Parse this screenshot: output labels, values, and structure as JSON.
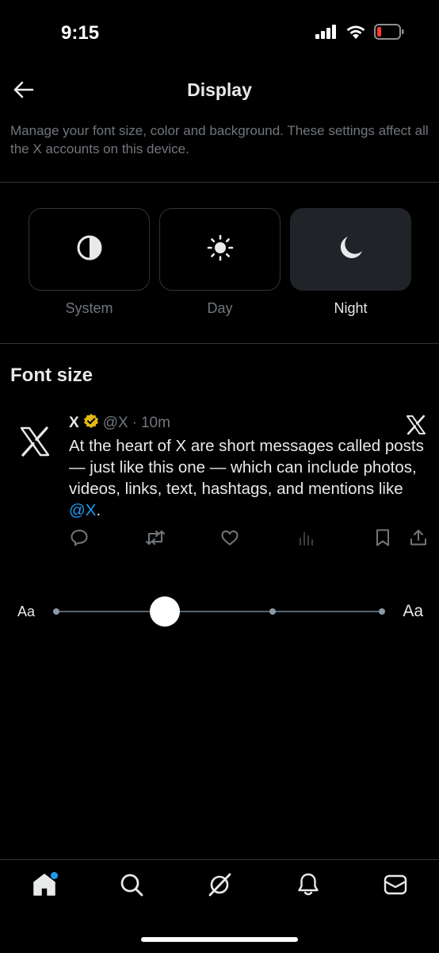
{
  "status_bar": {
    "time": "9:15",
    "icons": [
      "signal-icon",
      "wifi-icon",
      "battery-low-icon"
    ]
  },
  "header": {
    "title": "Display",
    "back_icon": "arrow-left-icon"
  },
  "description": "Manage your font size, color and background. These settings affect all the X accounts on this device.",
  "themes": [
    {
      "label": "System",
      "icon": "contrast-icon",
      "selected": false
    },
    {
      "label": "Day",
      "icon": "sun-icon",
      "selected": false
    },
    {
      "label": "Night",
      "icon": "moon-icon",
      "selected": true
    }
  ],
  "font_size": {
    "title": "Font size",
    "small_label": "Aa",
    "large_label": "Aa",
    "steps": 5,
    "selected_step": 2
  },
  "preview_post": {
    "name": "X",
    "verified": true,
    "handle": "@X",
    "dot": "·",
    "time": "10m",
    "text_before": "At the heart of X are short messages called posts — just like this one — which can include photos, videos, links, text, hashtags, and mentions like ",
    "mention": "@X",
    "text_after": ".",
    "actions": [
      "reply-icon",
      "repost-icon",
      "like-icon",
      "views-icon",
      "bookmark-icon",
      "share-icon"
    ]
  },
  "tabbar": {
    "tabs": [
      "home-icon",
      "search-icon",
      "grok-icon",
      "notifications-icon",
      "messages-icon"
    ],
    "home_has_badge": true
  },
  "colors": {
    "background": "#000000",
    "text": "#e7e9ea",
    "muted": "#71767b",
    "accent": "#1d9bf0",
    "verified": "#e2b719",
    "divider": "#2f3336"
  }
}
